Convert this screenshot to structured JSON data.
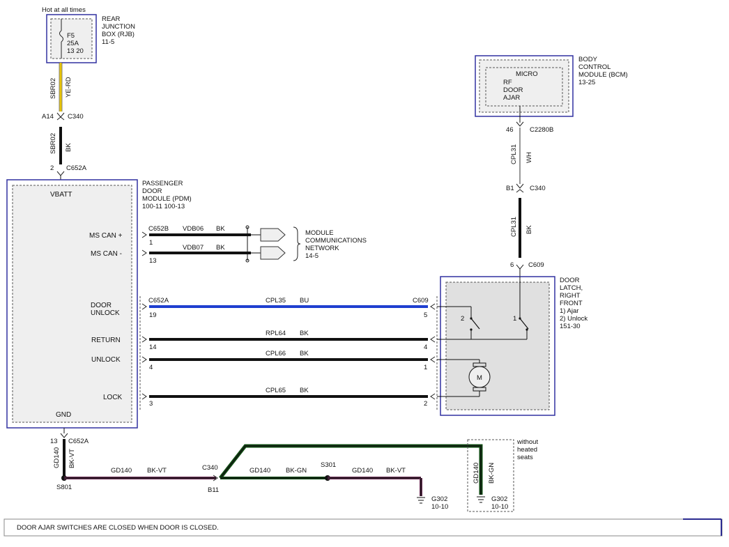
{
  "top": {
    "hot": "Hot at all times",
    "rjb": [
      "REAR",
      "JUNCTION",
      "BOX (RJB)",
      "11-5"
    ],
    "fuse": [
      "F5",
      "25A",
      "13 20"
    ]
  },
  "wires": {
    "sbr02_a": "SBR02",
    "yerd": "YE-RD",
    "a14": "A14",
    "c340": "C340",
    "sbr02_b": "SBR02",
    "bk": "BK",
    "pin2": "2",
    "c652a": "C652A",
    "cpl31_a": "CPL31",
    "wh": "WH",
    "b1": "B1",
    "c340b": "C340",
    "cpl31_b": "CPL31",
    "bk2": "BK",
    "pin6": "6",
    "c609": "C609",
    "pin46": "46",
    "c2280b": "C2280B"
  },
  "bcm": {
    "micro": "MICRO",
    "rf": [
      "RF",
      "DOOR",
      "AJAR"
    ],
    "label": [
      "BODY",
      "CONTROL",
      "MODULE (BCM)",
      "13-25"
    ]
  },
  "pdm": {
    "label": [
      "PASSENGER",
      "DOOR",
      "MODULE (PDM)",
      "100-11  100-13"
    ],
    "vbatt": "VBATT",
    "mscanp": "MS CAN +",
    "mscanm": "MS CAN -",
    "doorunlock": [
      "DOOR",
      "UNLOCK"
    ],
    "return": "RETURN",
    "unlock": "UNLOCK",
    "lock": "LOCK",
    "gnd": "GND"
  },
  "can": {
    "c652b": "C652B",
    "p1": "1",
    "p13": "13",
    "vdb06": "VDB06",
    "vdb07": "VDB07",
    "bk_a": "BK",
    "bk_b": "BK",
    "network": [
      "MODULE",
      "COMMUNICATIONS",
      "NETWORK",
      "14-5"
    ]
  },
  "circuits": {
    "c652a": "C652A",
    "c609": "C609",
    "cpl35": "CPL35",
    "bu": "BU",
    "p19": "19",
    "p5": "5",
    "rpl64": "RPL64",
    "bk1": "BK",
    "p14": "14",
    "p4": "4",
    "cpl66": "CPL66",
    "bk2": "BK",
    "p4b": "4",
    "p1": "1",
    "cpl65": "CPL65",
    "bk3": "BK",
    "p3": "3",
    "p2": "2"
  },
  "latch": {
    "label": [
      "DOOR",
      "LATCH,",
      "RIGHT",
      "FRONT",
      " 1) Ajar",
      " 2) Unlock",
      "151-30"
    ],
    "sw2": "2",
    "sw1": "1",
    "motor": "M"
  },
  "ground": {
    "p13": "13",
    "c652a": "C652A",
    "gd140a": "GD140",
    "bkvt_a": "BK-VT",
    "s801": "S801",
    "gd140b": "GD140",
    "bkvt_b": "BK-VT",
    "c340": "C340",
    "b11": "B11",
    "gd140c": "GD140",
    "bkgn_a": "BK-GN",
    "s301": "S301",
    "gd140d": "GD140",
    "bkvt_c": "BK-VT",
    "g302a": [
      "G302",
      "10-10"
    ],
    "without": [
      "without",
      "heated",
      "seats"
    ],
    "gd140e": "GD140",
    "bkgn_b": "BK-GN",
    "g302b": [
      "G302",
      "10-10"
    ]
  },
  "note": "DOOR AJAR SWITCHES ARE CLOSED WHEN DOOR IS CLOSED."
}
